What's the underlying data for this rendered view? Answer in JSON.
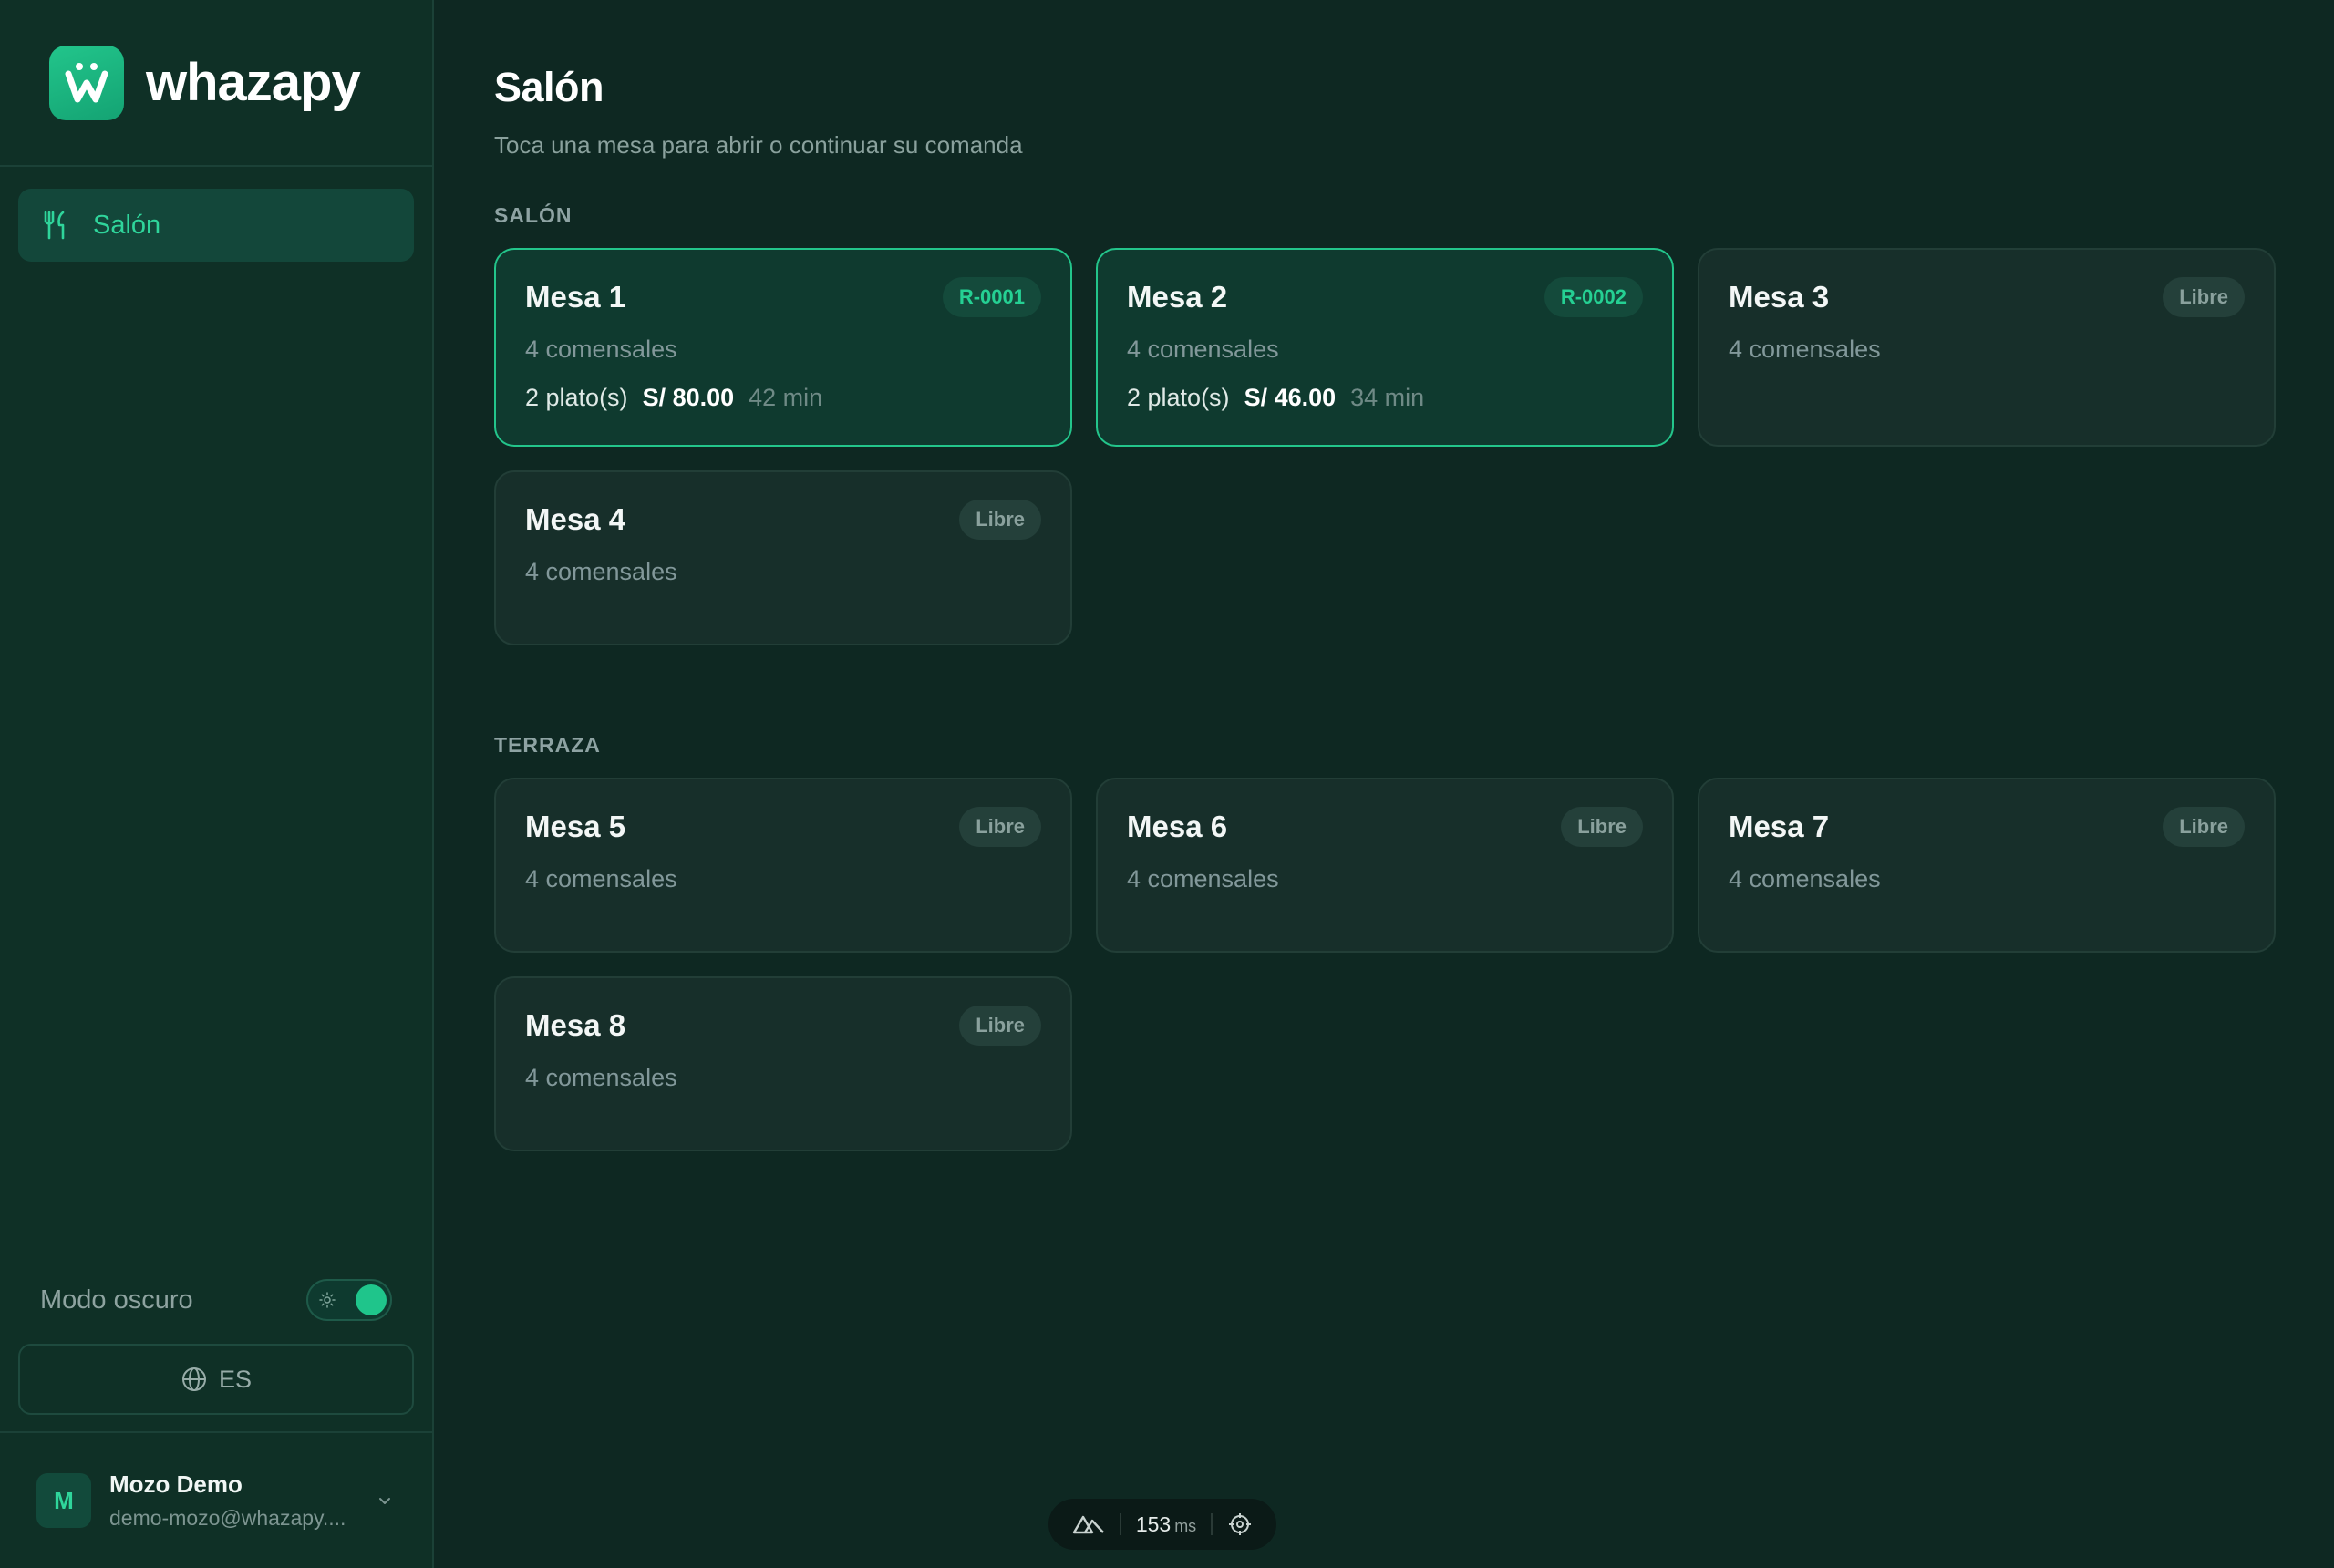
{
  "brand": {
    "name": "whazapy"
  },
  "nav": {
    "items": [
      {
        "label": "Salón",
        "icon": "utensils-icon",
        "active": true
      }
    ]
  },
  "settings": {
    "dark_mode_label": "Modo oscuro",
    "dark_mode_on": true,
    "language": "ES"
  },
  "user": {
    "initial": "M",
    "name": "Mozo Demo",
    "email": "demo-mozo@whazapy...."
  },
  "page": {
    "title": "Salón",
    "subtitle": "Toca una mesa para abrir o continuar su comanda"
  },
  "sections": [
    {
      "title": "SALÓN",
      "tables": [
        {
          "name": "Mesa 1",
          "badge": "R-0001",
          "occupied": true,
          "seats": "4 comensales",
          "plates": "2 plato(s)",
          "total": "S/ 80.00",
          "time": "42 min"
        },
        {
          "name": "Mesa 2",
          "badge": "R-0002",
          "occupied": true,
          "seats": "4 comensales",
          "plates": "2 plato(s)",
          "total": "S/ 46.00",
          "time": "34 min"
        },
        {
          "name": "Mesa 3",
          "badge": "Libre",
          "occupied": false,
          "seats": "4 comensales"
        },
        {
          "name": "Mesa 4",
          "badge": "Libre",
          "occupied": false,
          "seats": "4 comensales"
        }
      ]
    },
    {
      "title": "TERRAZA",
      "tables": [
        {
          "name": "Mesa 5",
          "badge": "Libre",
          "occupied": false,
          "seats": "4 comensales"
        },
        {
          "name": "Mesa 6",
          "badge": "Libre",
          "occupied": false,
          "seats": "4 comensales"
        },
        {
          "name": "Mesa 7",
          "badge": "Libre",
          "occupied": false,
          "seats": "4 comensales"
        },
        {
          "name": "Mesa 8",
          "badge": "Libre",
          "occupied": false,
          "seats": "4 comensales"
        }
      ]
    }
  ],
  "dev_toolbar": {
    "value": "153",
    "unit": "ms"
  },
  "colors": {
    "accent": "#22c58b",
    "background": "#0e2822",
    "sidebar": "#0f3026"
  }
}
